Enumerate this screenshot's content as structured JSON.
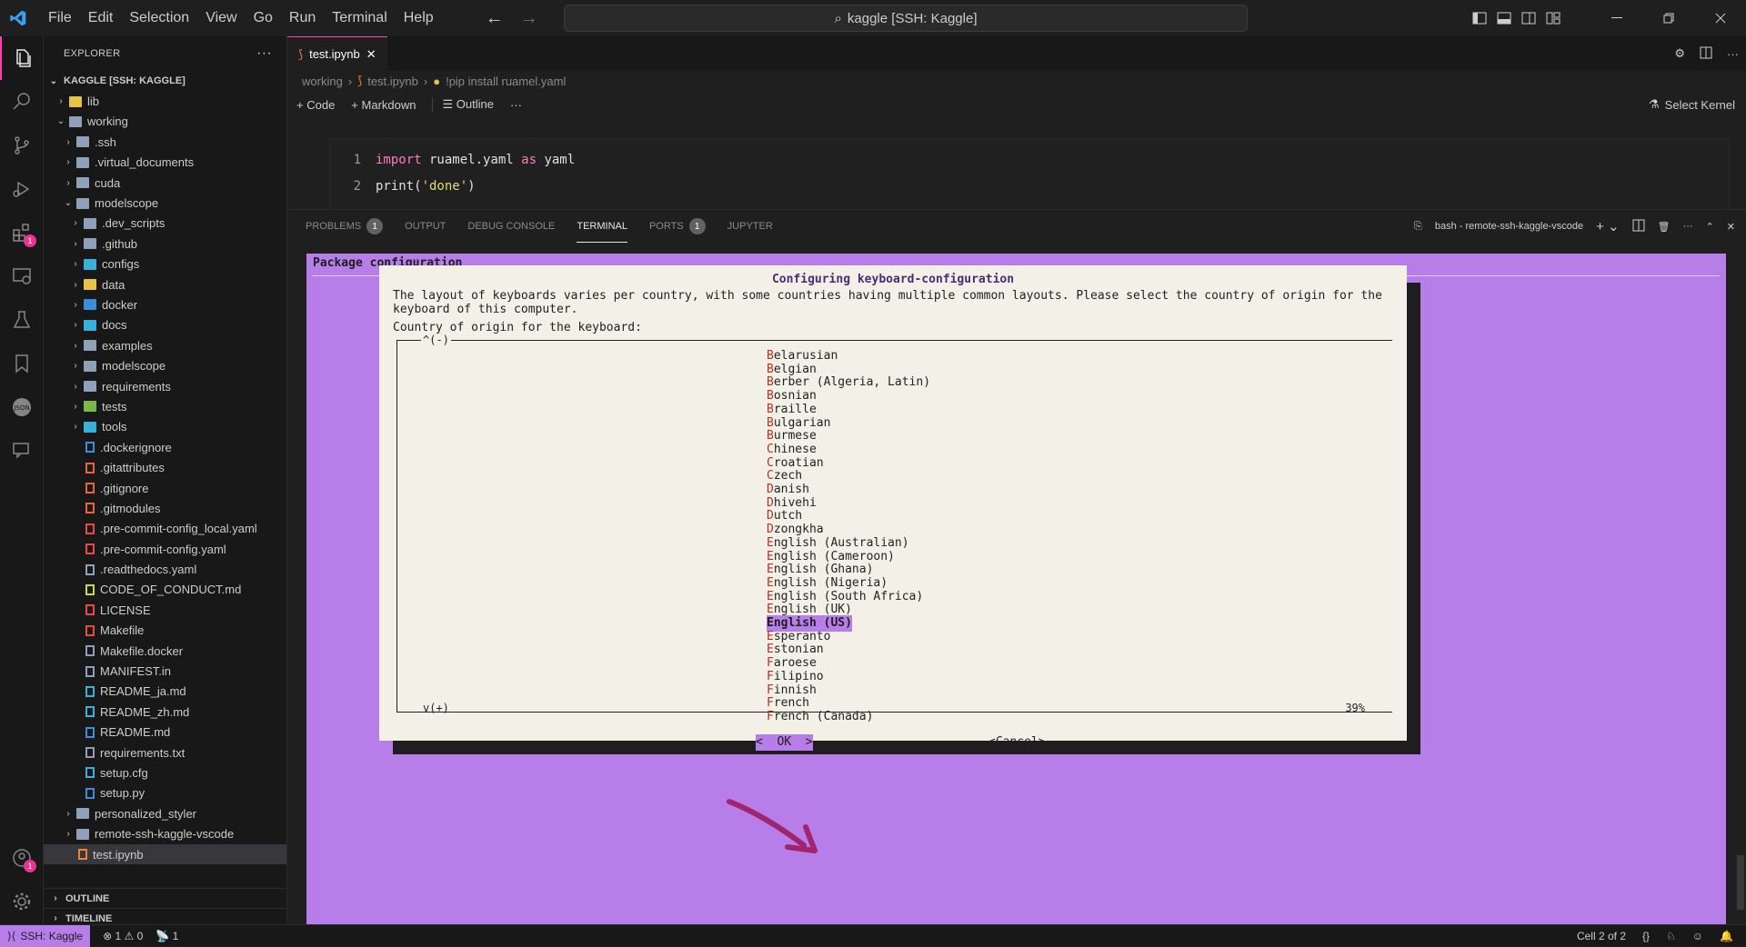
{
  "menu": [
    "File",
    "Edit",
    "Selection",
    "View",
    "Go",
    "Run",
    "Terminal",
    "Help"
  ],
  "command_center": "kaggle [SSH: Kaggle]",
  "explorer": {
    "title": "EXPLORER",
    "root": "KAGGLE [SSH: KAGGLE]",
    "items": [
      {
        "label": "lib",
        "depth": 1,
        "kind": "folder",
        "chev": "›",
        "color": "#e8c34a"
      },
      {
        "label": "working",
        "depth": 1,
        "kind": "folder",
        "chev": "⌄",
        "color": "#8ea1b8"
      },
      {
        "label": ".ssh",
        "depth": 2,
        "kind": "folder",
        "chev": "›",
        "color": "#8ea1b8"
      },
      {
        "label": ".virtual_documents",
        "depth": 2,
        "kind": "folder",
        "chev": "›",
        "color": "#8ea1b8"
      },
      {
        "label": "cuda",
        "depth": 2,
        "kind": "folder",
        "chev": "›",
        "color": "#8ea1b8"
      },
      {
        "label": "modelscope",
        "depth": 2,
        "kind": "folder",
        "chev": "⌄",
        "color": "#8ea1b8"
      },
      {
        "label": ".dev_scripts",
        "depth": 3,
        "kind": "folder",
        "chev": "›",
        "color": "#8ea1b8"
      },
      {
        "label": ".github",
        "depth": 3,
        "kind": "folder",
        "chev": "›",
        "color": "#8ea1b8"
      },
      {
        "label": "configs",
        "depth": 3,
        "kind": "folder",
        "chev": "›",
        "color": "#3ab0d8"
      },
      {
        "label": "data",
        "depth": 3,
        "kind": "folder",
        "chev": "›",
        "color": "#e8c34a"
      },
      {
        "label": "docker",
        "depth": 3,
        "kind": "folder",
        "chev": "›",
        "color": "#3a8fd8"
      },
      {
        "label": "docs",
        "depth": 3,
        "kind": "folder",
        "chev": "›",
        "color": "#3ab0d8"
      },
      {
        "label": "examples",
        "depth": 3,
        "kind": "folder",
        "chev": "›",
        "color": "#8ea1b8"
      },
      {
        "label": "modelscope",
        "depth": 3,
        "kind": "folder",
        "chev": "›",
        "color": "#8ea1b8"
      },
      {
        "label": "requirements",
        "depth": 3,
        "kind": "folder",
        "chev": "›",
        "color": "#8ea1b8"
      },
      {
        "label": "tests",
        "depth": 3,
        "kind": "folder",
        "chev": "›",
        "color": "#7ab84a"
      },
      {
        "label": "tools",
        "depth": 3,
        "kind": "folder",
        "chev": "›",
        "color": "#3ab0d8"
      },
      {
        "label": ".dockerignore",
        "depth": 3,
        "kind": "file",
        "chev": "",
        "color": "#3a8fd8"
      },
      {
        "label": ".gitattributes",
        "depth": 3,
        "kind": "file",
        "chev": "",
        "color": "#e8643a"
      },
      {
        "label": ".gitignore",
        "depth": 3,
        "kind": "file",
        "chev": "",
        "color": "#e8643a"
      },
      {
        "label": ".gitmodules",
        "depth": 3,
        "kind": "file",
        "chev": "",
        "color": "#e8643a"
      },
      {
        "label": ".pre-commit-config_local.yaml",
        "depth": 3,
        "kind": "file",
        "chev": "",
        "color": "#e84a4a"
      },
      {
        "label": ".pre-commit-config.yaml",
        "depth": 3,
        "kind": "file",
        "chev": "",
        "color": "#e84a4a"
      },
      {
        "label": ".readthedocs.yaml",
        "depth": 3,
        "kind": "file",
        "chev": "",
        "color": "#8ea1b8"
      },
      {
        "label": "CODE_OF_CONDUCT.md",
        "depth": 3,
        "kind": "file",
        "chev": "",
        "color": "#c8d84a"
      },
      {
        "label": "LICENSE",
        "depth": 3,
        "kind": "file",
        "chev": "",
        "color": "#e84a4a"
      },
      {
        "label": "Makefile",
        "depth": 3,
        "kind": "file",
        "chev": "",
        "color": "#e84a4a"
      },
      {
        "label": "Makefile.docker",
        "depth": 3,
        "kind": "file",
        "chev": "",
        "color": "#8ea1b8"
      },
      {
        "label": "MANIFEST.in",
        "depth": 3,
        "kind": "file",
        "chev": "",
        "color": "#8ea1b8"
      },
      {
        "label": "README_ja.md",
        "depth": 3,
        "kind": "file",
        "chev": "",
        "color": "#3ab0d8"
      },
      {
        "label": "README_zh.md",
        "depth": 3,
        "kind": "file",
        "chev": "",
        "color": "#3ab0d8"
      },
      {
        "label": "README.md",
        "depth": 3,
        "kind": "file",
        "chev": "",
        "color": "#3a8fd8"
      },
      {
        "label": "requirements.txt",
        "depth": 3,
        "kind": "file",
        "chev": "",
        "color": "#8ea1b8"
      },
      {
        "label": "setup.cfg",
        "depth": 3,
        "kind": "file",
        "chev": "",
        "color": "#3ab0d8"
      },
      {
        "label": "setup.py",
        "depth": 3,
        "kind": "file",
        "chev": "",
        "color": "#3a8fd8"
      },
      {
        "label": "personalized_styler",
        "depth": 2,
        "kind": "folder",
        "chev": "›",
        "color": "#8ea1b8"
      },
      {
        "label": "remote-ssh-kaggle-vscode",
        "depth": 2,
        "kind": "folder",
        "chev": "›",
        "color": "#8ea1b8"
      },
      {
        "label": "test.ipynb",
        "depth": 2,
        "kind": "file",
        "chev": "",
        "color": "#e8843a",
        "selected": true
      }
    ],
    "outline": "OUTLINE",
    "timeline": "TIMELINE"
  },
  "activity_badges": {
    "extensions": "1",
    "accounts": "1"
  },
  "editor": {
    "tab": "test.ipynb",
    "breadcrumb": [
      "working",
      "test.ipynb",
      "!pip install ruamel.yaml"
    ],
    "toolbar": {
      "code": "Code",
      "markdown": "Markdown",
      "outline": "Outline",
      "more": "···",
      "kernel": "Select Kernel"
    },
    "lines": [
      {
        "n": "1",
        "parts": [
          {
            "t": "import",
            "c": "kw"
          },
          {
            "t": " ruamel.yaml ",
            "c": ""
          },
          {
            "t": "as",
            "c": "kw"
          },
          {
            "t": " yaml",
            "c": ""
          }
        ]
      },
      {
        "n": "2",
        "parts": [
          {
            "t": "print(",
            "c": ""
          },
          {
            "t": "'done'",
            "c": "str"
          },
          {
            "t": ")",
            "c": ""
          }
        ]
      }
    ]
  },
  "panel": {
    "tabs": [
      {
        "label": "PROBLEMS",
        "count": "1"
      },
      {
        "label": "OUTPUT",
        "count": ""
      },
      {
        "label": "DEBUG CONSOLE",
        "count": ""
      },
      {
        "label": "TERMINAL",
        "count": "",
        "active": true
      },
      {
        "label": "PORTS",
        "count": "1"
      },
      {
        "label": "JUPYTER",
        "count": ""
      }
    ],
    "terminal_name": "bash - remote-ssh-kaggle-vscode"
  },
  "terminal": {
    "title": "Package configuration",
    "dialog_title": "Configuring keyboard-configuration",
    "description": "The layout of keyboards varies per country, with some countries having multiple common layouts. Please select the country of origin for the keyboard of this computer.",
    "prompt": "Country of origin for the keyboard:",
    "scroll_up": "^(-)",
    "scroll_down": "v(+)",
    "percent": "39%",
    "options": [
      "Belarusian",
      "Belgian",
      "Berber (Algeria, Latin)",
      "Bosnian",
      "Braille",
      "Bulgarian",
      "Burmese",
      "Chinese",
      "Croatian",
      "Czech",
      "Danish",
      "Dhivehi",
      "Dutch",
      "Dzongkha",
      "English (Australian)",
      "English (Cameroon)",
      "English (Ghana)",
      "English (Nigeria)",
      "English (South Africa)",
      "English (UK)",
      "English (US)",
      "Esperanto",
      "Estonian",
      "Faroese",
      "Filipino",
      "Finnish",
      "French",
      "French (Canada)"
    ],
    "selected": "English (US)",
    "ok": "<  OK  >",
    "cancel": "<Cancel>"
  },
  "annotation_color": "#a0246e",
  "status": {
    "remote": "SSH: Kaggle",
    "errors": "1",
    "warnings": "0",
    "ports": "1",
    "cell": "Cell 2 of 2"
  }
}
